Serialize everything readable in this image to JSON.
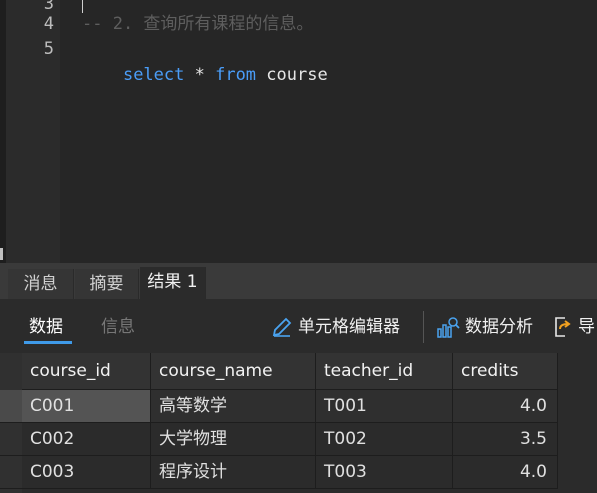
{
  "editor": {
    "lines": [
      {
        "num": "3",
        "text": ""
      },
      {
        "num": "4",
        "comment": "-- 2. 查询所有课程的信息。"
      },
      {
        "num": "5",
        "kw1": "select",
        "mid": " * ",
        "kw2": "from",
        "rest": " course"
      }
    ]
  },
  "tabs": [
    {
      "label": "消息"
    },
    {
      "label": "摘要"
    },
    {
      "label": "结果 1"
    }
  ],
  "toolbar": {
    "data_tab": "数据",
    "info_tab": "信息",
    "cell_editor": "单元格编辑器",
    "data_analysis": "数据分析",
    "export": "导"
  },
  "table": {
    "columns": [
      "course_id",
      "course_name",
      "teacher_id",
      "credits"
    ],
    "rows": [
      [
        "C001",
        "高等数学",
        "T001",
        "4.0"
      ],
      [
        "C002",
        "大学物理",
        "T002",
        "3.5"
      ],
      [
        "C003",
        "程序设计",
        "T003",
        "4.0"
      ]
    ]
  },
  "colors": {
    "keyword": "#4a9df8",
    "accent": "#3f9ae8"
  }
}
